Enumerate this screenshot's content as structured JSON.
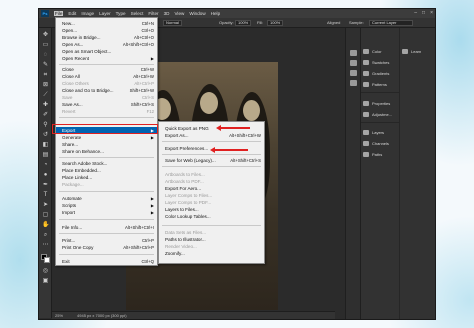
{
  "menubar": {
    "logo": "Ps",
    "items": [
      "File",
      "Edit",
      "Image",
      "Layer",
      "Type",
      "Select",
      "Filter",
      "3D",
      "View",
      "Window",
      "Help"
    ],
    "window_controls": [
      "–",
      "□",
      "×"
    ]
  },
  "options_bar": {
    "mode_value": "Normal",
    "opacity_label": "Opacity:",
    "opacity_value": "100%",
    "fill_label": "Fill:",
    "fill_value": "100%",
    "aligned_label": "Aligned",
    "sample_label": "Sample:",
    "sample_value": "Current Layer"
  },
  "file_menu": {
    "items": [
      {
        "label": "New...",
        "shortcut": "Ctrl+N",
        "disabled": false
      },
      {
        "label": "Open...",
        "shortcut": "Ctrl+O",
        "disabled": false
      },
      {
        "label": "Browse in Bridge...",
        "shortcut": "Alt+Ctrl+O",
        "disabled": false
      },
      {
        "label": "Open As...",
        "shortcut": "Alt+Shift+Ctrl+O",
        "disabled": false
      },
      {
        "label": "Open as Smart Object...",
        "shortcut": "",
        "disabled": false
      },
      {
        "label": "Open Recent",
        "shortcut": "",
        "disabled": false,
        "submenu": true
      },
      {
        "label": "Close",
        "shortcut": "Ctrl+W",
        "disabled": false
      },
      {
        "label": "Close All",
        "shortcut": "Alt+Ctrl+W",
        "disabled": false
      },
      {
        "label": "Close Others",
        "shortcut": "Alt+Ctrl+P",
        "disabled": true
      },
      {
        "label": "Close and Go to Bridge...",
        "shortcut": "Shift+Ctrl+W",
        "disabled": false
      },
      {
        "label": "Save",
        "shortcut": "Ctrl+S",
        "disabled": true
      },
      {
        "label": "Save As...",
        "shortcut": "Shift+Ctrl+S",
        "disabled": false
      },
      {
        "label": "Revert",
        "shortcut": "F12",
        "disabled": true
      },
      {
        "label": "Export",
        "shortcut": "",
        "disabled": false,
        "submenu": true,
        "highlighted": true
      },
      {
        "label": "Generate",
        "shortcut": "",
        "disabled": false,
        "submenu": true
      },
      {
        "label": "Share...",
        "shortcut": "",
        "disabled": false
      },
      {
        "label": "Share on Behance...",
        "shortcut": "",
        "disabled": false
      },
      {
        "label": "Search Adobe Stock...",
        "shortcut": "",
        "disabled": false
      },
      {
        "label": "Place Embedded...",
        "shortcut": "",
        "disabled": false
      },
      {
        "label": "Place Linked...",
        "shortcut": "",
        "disabled": false
      },
      {
        "label": "Package...",
        "shortcut": "",
        "disabled": true
      },
      {
        "label": "Automate",
        "shortcut": "",
        "disabled": false,
        "submenu": true
      },
      {
        "label": "Scripts",
        "shortcut": "",
        "disabled": false,
        "submenu": true
      },
      {
        "label": "Import",
        "shortcut": "",
        "disabled": false,
        "submenu": true
      },
      {
        "label": "File Info...",
        "shortcut": "Alt+Shift+Ctrl+I",
        "disabled": false
      },
      {
        "label": "Print...",
        "shortcut": "Ctrl+P",
        "disabled": false
      },
      {
        "label": "Print One Copy",
        "shortcut": "Alt+Shift+Ctrl+P",
        "disabled": false
      },
      {
        "label": "Exit",
        "shortcut": "Ctrl+Q",
        "disabled": false
      }
    ]
  },
  "export_menu": {
    "items": [
      {
        "label": "Quick Export as PNG",
        "shortcut": "",
        "disabled": false
      },
      {
        "label": "Export As...",
        "shortcut": "Alt+Shift+Ctrl+W",
        "disabled": false
      },
      {
        "label": "Export Preferences...",
        "shortcut": "",
        "disabled": false
      },
      {
        "label": "Save for Web (Legacy)...",
        "shortcut": "Alt+Shift+Ctrl+S",
        "disabled": false
      },
      {
        "label": "Artboards to Files...",
        "shortcut": "",
        "disabled": true
      },
      {
        "label": "Artboards to PDF...",
        "shortcut": "",
        "disabled": true
      },
      {
        "label": "Export For Aero...",
        "shortcut": "",
        "disabled": false
      },
      {
        "label": "Layer Comps to Files...",
        "shortcut": "",
        "disabled": true
      },
      {
        "label": "Layer Comps to PDF...",
        "shortcut": "",
        "disabled": true
      },
      {
        "label": "Layers to Files...",
        "shortcut": "",
        "disabled": false
      },
      {
        "label": "Color Lookup Tables...",
        "shortcut": "",
        "disabled": false
      },
      {
        "label": "Data Sets as Files...",
        "shortcut": "",
        "disabled": true
      },
      {
        "label": "Paths to Illustrator...",
        "shortcut": "",
        "disabled": false
      },
      {
        "label": "Render Video...",
        "shortcut": "",
        "disabled": true
      },
      {
        "label": "Zoomify...",
        "shortcut": "",
        "disabled": false
      }
    ]
  },
  "panels": {
    "col1": [
      "Color",
      "Swatches",
      "Gradients",
      "Patterns",
      "Properties",
      "Adjustme...",
      "Layers",
      "Channels",
      "Paths"
    ],
    "col2": [
      "Learn"
    ]
  },
  "status_bar": {
    "zoom": "25%",
    "doc_info": "4945 px x 7000 px (300 ppi)"
  },
  "colors": {
    "accent": "#0063b1",
    "annotation": "#e02020",
    "ps_logo": "#31a8ff"
  }
}
